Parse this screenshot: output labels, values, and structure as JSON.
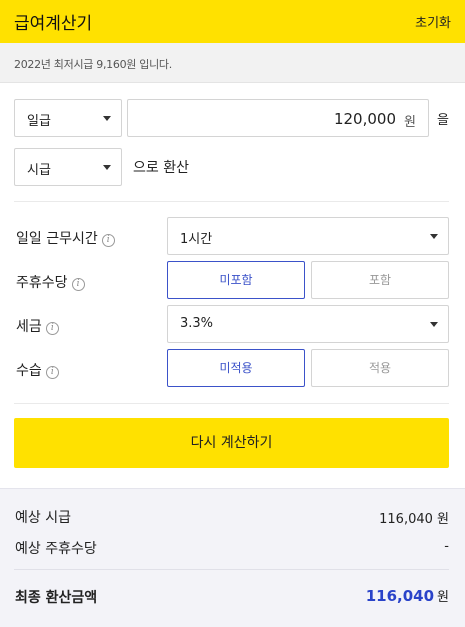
{
  "header": {
    "title": "급여계산기",
    "reset_label": "초기화"
  },
  "notice": "2022년 최저시급 9,160원 입니다.",
  "input": {
    "period_select": "일급",
    "amount": "120,000",
    "amount_unit": "원",
    "particle": "을",
    "target_select": "시급",
    "convert_text": "으로 환산"
  },
  "options": {
    "work_hours": {
      "label": "일일 근무시간",
      "value": "1시간"
    },
    "holiday_allowance": {
      "label": "주휴수당",
      "options": [
        "미포함",
        "포함"
      ],
      "selected": "미포함"
    },
    "tax": {
      "label": "세금",
      "value": "3.3%"
    },
    "probation": {
      "label": "수습",
      "options": [
        "미적용",
        "적용"
      ],
      "selected": "미적용"
    }
  },
  "button": {
    "recalc_label": "다시 계산하기"
  },
  "result": {
    "hourly_label": "예상 시급",
    "hourly_value": "116,040 원",
    "holiday_label": "예상 주휴수당",
    "holiday_value": "-",
    "final_label": "최종 환산금액",
    "final_amount": "116,040",
    "final_unit": "원"
  },
  "colors": {
    "header_bg": "#ffe100",
    "accent_blue": "#3b52c9",
    "button_bg": "#ffe100"
  },
  "icons": {
    "info": "info-circle-icon",
    "dropdown": "caret-down-icon"
  }
}
